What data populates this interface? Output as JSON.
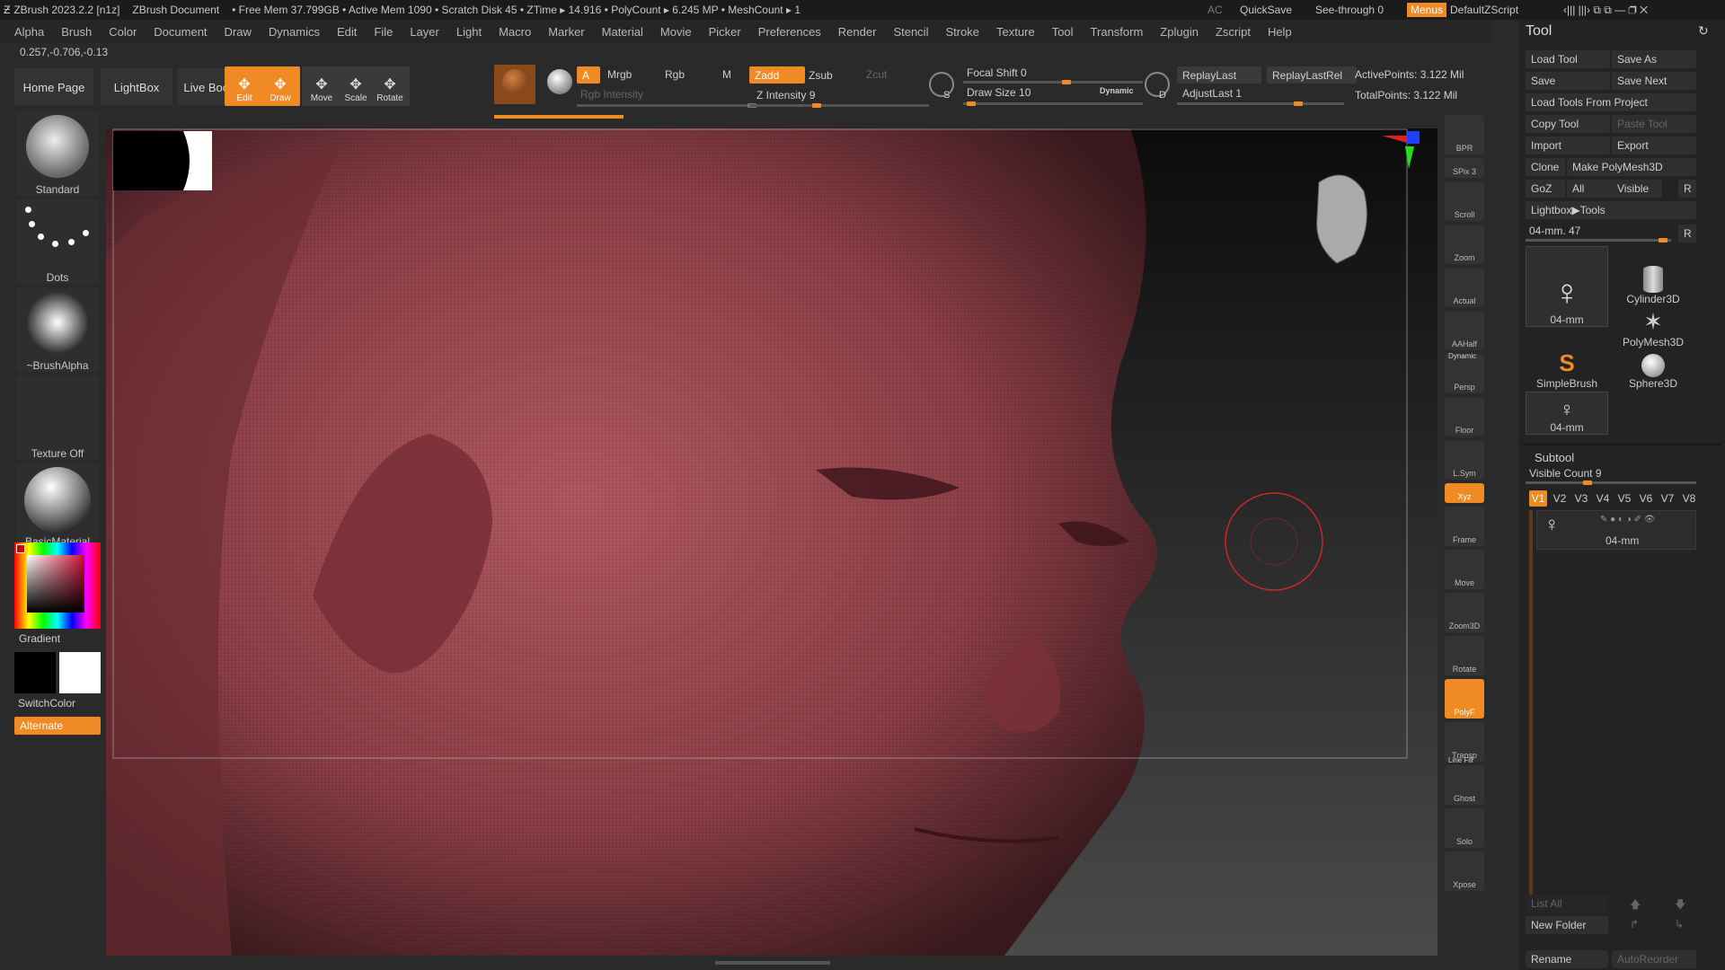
{
  "titlebar": {
    "app": "ZBrush 2023.2.2 [n1z]",
    "document": "ZBrush Document",
    "stats": "• Free Mem 37.799GB • Active Mem 1090 • Scratch Disk 45 • ZTime ▸ 14.916 • PolyCount ▸ 6.245 MP • MeshCount ▸ 1",
    "ac": "AC",
    "quicksave": "QuickSave",
    "see_through": "See-through  0",
    "menus": "Menus",
    "zscript": "DefaultZScript"
  },
  "menubar": [
    "Alpha",
    "Brush",
    "Color",
    "Document",
    "Draw",
    "Dynamics",
    "Edit",
    "File",
    "Layer",
    "Light",
    "Macro",
    "Marker",
    "Material",
    "Movie",
    "Picker",
    "Preferences",
    "Render",
    "Stencil",
    "Stroke",
    "Texture",
    "Tool",
    "Transform",
    "Zplugin",
    "Zscript",
    "Help"
  ],
  "coords": "0.257,-0.706,-0.13",
  "shelf": {
    "home": "Home Page",
    "lightbox": "LightBox",
    "live_boolean": "Live Boolean",
    "tools": [
      {
        "label": "Edit",
        "on": true
      },
      {
        "label": "Draw",
        "on": true
      },
      {
        "label": "Move",
        "on": false
      },
      {
        "label": "Scale",
        "on": false
      },
      {
        "label": "Rotate",
        "on": false
      }
    ],
    "a": "A",
    "mrgb": "Mrgb",
    "rgb": "Rgb",
    "m": "M",
    "rgb_intensity": "Rgb Intensity",
    "zadd": "Zadd",
    "zsub": "Zsub",
    "zcut": "Zcut",
    "z_intensity": "Z Intensity 9",
    "z_intensity_value": 9,
    "focal_shift": "Focal Shift 0",
    "draw_size": "Draw Size 10",
    "dynamic": "Dynamic",
    "replay_last": "ReplayLast",
    "replay_last_rel": "ReplayLastRel",
    "adjust_last": "AdjustLast 1",
    "active_points": "ActivePoints: 3.122 Mil",
    "total_points": "TotalPoints: 3.122 Mil",
    "s_label": "S",
    "d_label": "D"
  },
  "left": {
    "brush": "Standard",
    "stroke": "Dots",
    "alpha": "~BrushAlpha",
    "texture": "Texture Off",
    "material": "BasicMaterial",
    "gradient": "Gradient",
    "switch_color": "SwitchColor",
    "alternate": "Alternate"
  },
  "right_tools": [
    {
      "label": "BPR",
      "on": false
    },
    {
      "label": "SPix 3",
      "on": false
    },
    {
      "label": "Scroll",
      "on": false
    },
    {
      "label": "Zoom",
      "on": false
    },
    {
      "label": "Actual",
      "on": false
    },
    {
      "label": "AAHalf",
      "on": false
    },
    {
      "label": "Persp",
      "on": false
    },
    {
      "label": "Floor",
      "on": false
    },
    {
      "label": "L.Sym",
      "on": false
    },
    {
      "label": "Xyz",
      "on": true
    },
    {
      "label": "Frame",
      "on": false
    },
    {
      "label": "Move",
      "on": false
    },
    {
      "label": "Zoom3D",
      "on": false
    },
    {
      "label": "Rotate",
      "on": false
    },
    {
      "label": "PolyF",
      "on": true
    },
    {
      "label": "Transp",
      "on": false
    },
    {
      "label": "Ghost",
      "on": false
    },
    {
      "label": "Solo",
      "on": false
    },
    {
      "label": "Xpose",
      "on": false
    }
  ],
  "right_misc": {
    "dynamic": "Dynamic",
    "line_fill": "Line Fill"
  },
  "tool": {
    "header": "Tool",
    "load_tool": "Load Tool",
    "save_as": "Save As",
    "save": "Save",
    "save_next": "Save Next",
    "load_from_project": "Load Tools From Project",
    "copy_tool": "Copy Tool",
    "paste_tool": "Paste Tool",
    "import": "Import",
    "export": "Export",
    "clone": "Clone",
    "make_polymesh": "Make PolyMesh3D",
    "goz": "GoZ",
    "all": "All",
    "visible": "Visible",
    "r": "R",
    "lightbox_tools": "Lightbox▶Tools",
    "current": "04-mm. 47",
    "thumbs": [
      "04-mm",
      "Cylinder3D",
      "PolyMesh3D",
      "SimpleBrush",
      "Sphere3D",
      "04-mm"
    ],
    "subtool": "Subtool",
    "visible_count": "Visible Count 9",
    "vtabs": [
      "V1",
      "V2",
      "V3",
      "V4",
      "V5",
      "V6",
      "V7",
      "V8"
    ],
    "subtool_name": "04-mm",
    "list_all": "List All",
    "new_folder": "New Folder",
    "rename": "Rename",
    "auto_reorder": "AutoReorder"
  },
  "colors": {
    "accent": "#f08a24",
    "skin": "#a04a50",
    "bg": "#2a2a2a"
  }
}
